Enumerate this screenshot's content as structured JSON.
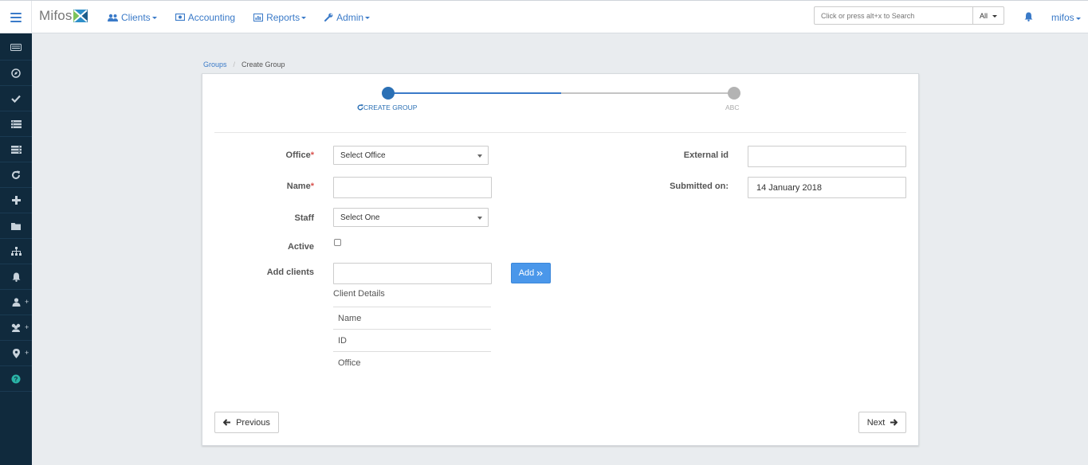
{
  "app": {
    "brand": "Mifos",
    "colors": {
      "accent": "#3a7ac8",
      "sidebar": "#102a3d",
      "primary_button": "#4a97ea",
      "required": "#d9534f"
    }
  },
  "nav": {
    "items": [
      {
        "label": "Clients",
        "icon": "users-icon",
        "dropdown": true
      },
      {
        "label": "Accounting",
        "icon": "money-icon",
        "dropdown": false
      },
      {
        "label": "Reports",
        "icon": "bar-chart-icon",
        "dropdown": true
      },
      {
        "label": "Admin",
        "icon": "wrench-icon",
        "dropdown": true
      }
    ]
  },
  "search": {
    "placeholder": "Click or press alt+x to Search",
    "scope": "All"
  },
  "user": {
    "name": "mifos"
  },
  "sidebar": {
    "items": [
      {
        "icon": "keyboard-icon"
      },
      {
        "icon": "compass-icon"
      },
      {
        "icon": "check-icon"
      },
      {
        "icon": "list-icon"
      },
      {
        "icon": "list-alt-icon"
      },
      {
        "icon": "refresh-icon"
      },
      {
        "icon": "plus-icon"
      },
      {
        "icon": "folder-icon"
      },
      {
        "icon": "sitemap-icon"
      },
      {
        "icon": "bell-icon"
      },
      {
        "icon": "user-plus-icon",
        "plus": "+"
      },
      {
        "icon": "users-plus-icon",
        "plus": "+"
      },
      {
        "icon": "map-marker-plus-icon",
        "plus": "+"
      },
      {
        "icon": "help-icon"
      }
    ]
  },
  "breadcrumb": {
    "parent": "Groups",
    "separator": "/",
    "current": "Create Group"
  },
  "stepper": {
    "steps": [
      {
        "label": "CREATE GROUP",
        "state": "active"
      },
      {
        "label": "ABC",
        "state": "idle"
      }
    ]
  },
  "form": {
    "office": {
      "label": "Office",
      "required_mark": "*",
      "value": "Select Office"
    },
    "name": {
      "label": "Name",
      "required_mark": "*",
      "value": ""
    },
    "staff": {
      "label": "Staff",
      "value": "Select One"
    },
    "active": {
      "label": "Active",
      "checked": false
    },
    "add_clients": {
      "label": "Add clients",
      "value": "",
      "button": "Add"
    },
    "external_id": {
      "label": "External id",
      "value": ""
    },
    "submitted_on": {
      "label": "Submitted on:",
      "value": "14 January 2018"
    },
    "client_details": {
      "title": "Client Details",
      "rows": [
        "Name",
        "ID",
        "Office"
      ]
    }
  },
  "footer": {
    "previous": "Previous",
    "next": "Next"
  }
}
